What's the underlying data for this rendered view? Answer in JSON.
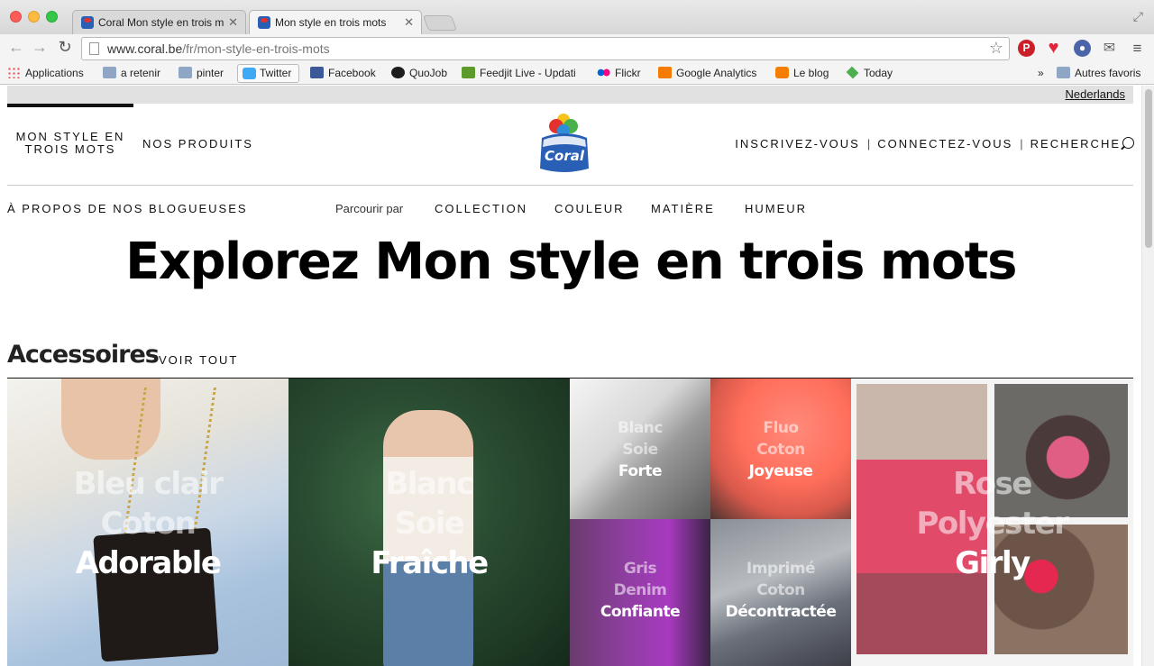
{
  "browser": {
    "tabs": [
      {
        "label": "Coral Mon style en trois m",
        "active": false
      },
      {
        "label": "Mon style en trois mots",
        "active": true
      }
    ],
    "url_host": "www.coral.be",
    "url_path": "/fr/mon-style-en-trois-mots",
    "bookmarks": [
      {
        "label": "Applications",
        "icon": "apps-icon"
      },
      {
        "label": "a retenir",
        "icon": "folder-icon"
      },
      {
        "label": "pinter",
        "icon": "folder-icon"
      },
      {
        "label": "Twitter",
        "icon": "twitter-icon"
      },
      {
        "label": "Facebook",
        "icon": "facebook-icon"
      },
      {
        "label": "QuoJob",
        "icon": "quojob-icon"
      },
      {
        "label": "Feedjit Live - Updati",
        "icon": "feedjit-icon"
      },
      {
        "label": "Flickr",
        "icon": "flickr-icon"
      },
      {
        "label": "Google Analytics",
        "icon": "google-analytics-icon"
      },
      {
        "label": "Le blog",
        "icon": "blogger-icon"
      },
      {
        "label": "Today",
        "icon": "today-icon"
      }
    ],
    "bookmarks_overflow": "»",
    "other_bookmarks": "Autres favoris"
  },
  "site": {
    "lang_link": "Nederlands",
    "nav": {
      "style_line1": "MON STYLE EN",
      "style_line2": "TROIS MOTS",
      "produits": "NOS PRODUITS",
      "inscrivez": "INSCRIVEZ-VOUS",
      "connectez": "CONNECTEZ-VOUS",
      "recherche": "RECHERCHE",
      "sep": "|"
    },
    "logo_text": "Coral",
    "subnav": {
      "about": "À PROPOS DE NOS BLOGUEUSES",
      "browse_label": "Parcourir par",
      "collection": "COLLECTION",
      "couleur": "COULEUR",
      "matiere": "MATIÈRE",
      "humeur": "HUMEUR"
    },
    "title": "Explorez Mon style en trois mots",
    "section": {
      "title": "Accessoires",
      "voir_tout": "VOIR TOUT"
    },
    "tiles": [
      {
        "w1": "Bleu clair",
        "w2": "Coton",
        "w3": "Adorable"
      },
      {
        "w1": "Blanc",
        "w2": "Soie",
        "w3": "Fraîche"
      },
      {
        "w1": "Blanc",
        "w2": "Soie",
        "w3": "Forte"
      },
      {
        "w1": "Fluo",
        "w2": "Coton",
        "w3": "Joyeuse"
      },
      {
        "w1": "Gris",
        "w2": "Denim",
        "w3": "Confiante"
      },
      {
        "w1": "Imprimé",
        "w2": "Coton",
        "w3": "Décontractée"
      },
      {
        "w1": "Rose",
        "w2": "Polyester",
        "w3": "Girly"
      }
    ]
  },
  "colors": {
    "text": "#111111",
    "langbar": "#e1e1e1",
    "brand_blue": "#2a5fb6",
    "brand_red": "#e4312b"
  }
}
